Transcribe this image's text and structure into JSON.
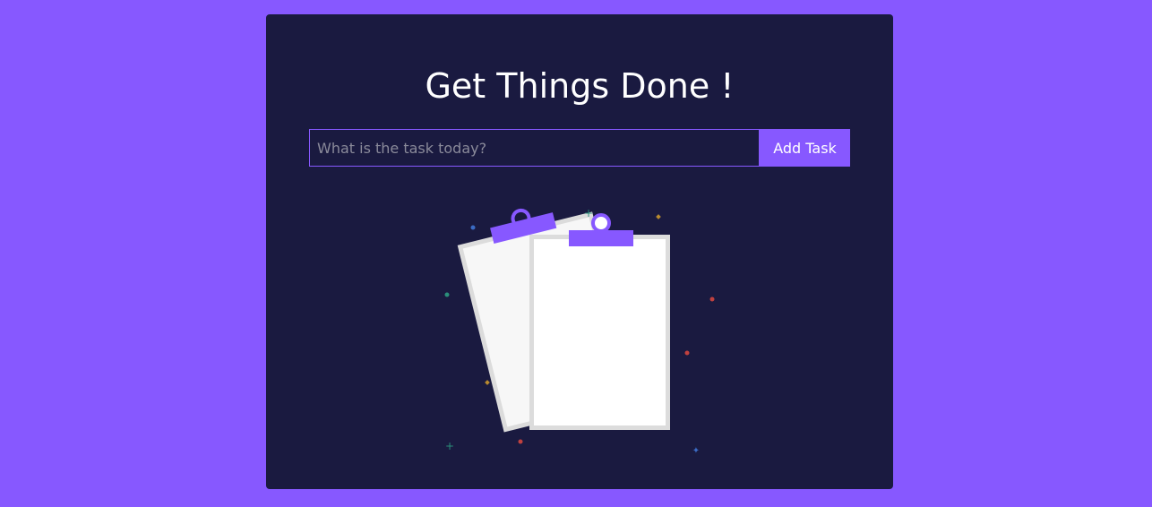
{
  "colors": {
    "page_background": "#8758ff",
    "panel_background": "#1a1a40",
    "accent": "#8758ff",
    "title_text": "#ffffff",
    "paper": "#ffffff",
    "paper_back": "#f7f7f7",
    "paper_border": "#dcdcdc",
    "confetti": [
      "#2b8f7a",
      "#3b6bc4",
      "#c0413f",
      "#b88a2f"
    ]
  },
  "header": {
    "title": "Get Things Done !"
  },
  "task_form": {
    "placeholder": "What is the task today?",
    "value": "",
    "submit_label": "Add Task"
  },
  "empty_state": {
    "icon": "clipboards-illustration"
  }
}
